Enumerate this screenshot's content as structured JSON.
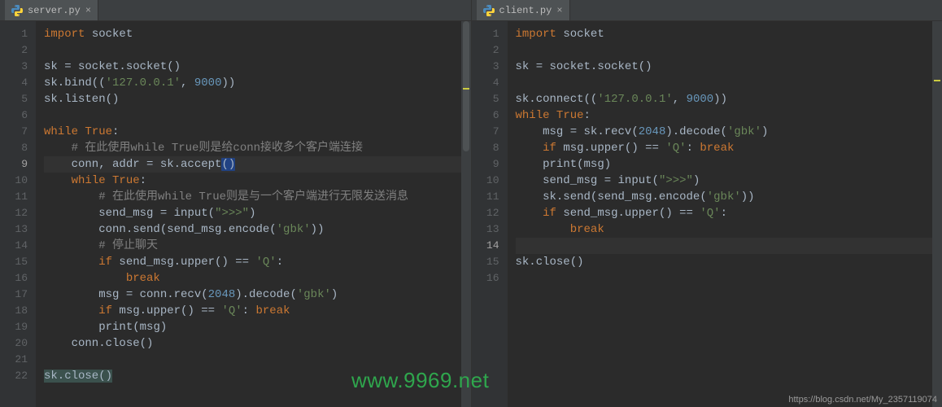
{
  "left": {
    "tab": {
      "filename": "server.py",
      "icon": "py-icon"
    },
    "current_line": 9,
    "lines": [
      {
        "n": 1,
        "tokens": [
          [
            "kw",
            "import"
          ],
          [
            "ident",
            " socket"
          ]
        ]
      },
      {
        "n": 2,
        "tokens": []
      },
      {
        "n": 3,
        "tokens": [
          [
            "ident",
            "sk = socket.socket()"
          ]
        ]
      },
      {
        "n": 4,
        "tokens": [
          [
            "ident",
            "sk.bind(("
          ],
          [
            "str",
            "'127.0.0.1'"
          ],
          [
            "ident",
            ", "
          ],
          [
            "num",
            "9000"
          ],
          [
            "ident",
            "))"
          ]
        ]
      },
      {
        "n": 5,
        "tokens": [
          [
            "ident",
            "sk.listen()"
          ]
        ]
      },
      {
        "n": 6,
        "tokens": []
      },
      {
        "n": 7,
        "tokens": [
          [
            "kw",
            "while "
          ],
          [
            "kw",
            "True"
          ],
          [
            "ident",
            ":"
          ]
        ]
      },
      {
        "n": 8,
        "tokens": [
          [
            "ident",
            "    "
          ],
          [
            "cm",
            "# 在此使用while True则是给conn接收多个客户端连接"
          ]
        ]
      },
      {
        "n": 9,
        "tokens": [
          [
            "ident",
            "    conn, addr = sk.accept"
          ],
          [
            "selbox",
            "()"
          ]
        ],
        "hl": true
      },
      {
        "n": 10,
        "tokens": [
          [
            "ident",
            "    "
          ],
          [
            "kw",
            "while "
          ],
          [
            "kw",
            "True"
          ],
          [
            "ident",
            ":"
          ]
        ]
      },
      {
        "n": 11,
        "tokens": [
          [
            "ident",
            "        "
          ],
          [
            "cm",
            "# 在此使用while True则是与一个客户端进行无限发送消息"
          ]
        ]
      },
      {
        "n": 12,
        "tokens": [
          [
            "ident",
            "        send_msg = "
          ],
          [
            "ident",
            "input"
          ],
          [
            "ident",
            "("
          ],
          [
            "str",
            "\">>>\""
          ],
          [
            "ident",
            ")"
          ]
        ]
      },
      {
        "n": 13,
        "tokens": [
          [
            "ident",
            "        conn.send(send_msg.encode("
          ],
          [
            "str",
            "'gbk'"
          ],
          [
            "ident",
            "))"
          ]
        ]
      },
      {
        "n": 14,
        "tokens": [
          [
            "ident",
            "        "
          ],
          [
            "cm",
            "# 停止聊天"
          ]
        ]
      },
      {
        "n": 15,
        "tokens": [
          [
            "ident",
            "        "
          ],
          [
            "kw",
            "if"
          ],
          [
            "ident",
            " send_msg.upper() == "
          ],
          [
            "str",
            "'Q'"
          ],
          [
            "ident",
            ":"
          ]
        ]
      },
      {
        "n": 16,
        "tokens": [
          [
            "ident",
            "            "
          ],
          [
            "kw",
            "break"
          ]
        ]
      },
      {
        "n": 17,
        "tokens": [
          [
            "ident",
            "        msg = conn.recv("
          ],
          [
            "num",
            "2048"
          ],
          [
            "ident",
            ").decode("
          ],
          [
            "str",
            "'gbk'"
          ],
          [
            "ident",
            ")"
          ]
        ]
      },
      {
        "n": 18,
        "tokens": [
          [
            "ident",
            "        "
          ],
          [
            "kw",
            "if"
          ],
          [
            "ident",
            " msg.upper() == "
          ],
          [
            "str",
            "'Q'"
          ],
          [
            "ident",
            ": "
          ],
          [
            "kw",
            "break"
          ]
        ]
      },
      {
        "n": 19,
        "tokens": [
          [
            "ident",
            "        "
          ],
          [
            "ident",
            "print"
          ],
          [
            "ident",
            "(msg)"
          ]
        ]
      },
      {
        "n": 20,
        "tokens": [
          [
            "ident",
            "    conn.close()"
          ]
        ]
      },
      {
        "n": 21,
        "tokens": []
      },
      {
        "n": 22,
        "tokens": [
          [
            "selbox-dim",
            "sk.close()"
          ]
        ]
      }
    ]
  },
  "right": {
    "tab": {
      "filename": "client.py",
      "icon": "py-icon"
    },
    "current_line": 14,
    "lines": [
      {
        "n": 1,
        "tokens": [
          [
            "kw",
            "import"
          ],
          [
            "ident",
            " socket"
          ]
        ]
      },
      {
        "n": 2,
        "tokens": []
      },
      {
        "n": 3,
        "tokens": [
          [
            "ident",
            "sk = socket.socket()"
          ]
        ]
      },
      {
        "n": 4,
        "tokens": []
      },
      {
        "n": 5,
        "tokens": [
          [
            "ident",
            "sk.connect(("
          ],
          [
            "str",
            "'127.0.0.1'"
          ],
          [
            "ident",
            ", "
          ],
          [
            "num",
            "9000"
          ],
          [
            "ident",
            "))"
          ]
        ]
      },
      {
        "n": 6,
        "tokens": [
          [
            "kw",
            "while "
          ],
          [
            "kw",
            "True"
          ],
          [
            "ident",
            ":"
          ]
        ]
      },
      {
        "n": 7,
        "tokens": [
          [
            "ident",
            "    msg = sk.recv("
          ],
          [
            "num",
            "2048"
          ],
          [
            "ident",
            ").decode("
          ],
          [
            "str",
            "'gbk'"
          ],
          [
            "ident",
            ")"
          ]
        ]
      },
      {
        "n": 8,
        "tokens": [
          [
            "ident",
            "    "
          ],
          [
            "kw",
            "if"
          ],
          [
            "ident",
            " msg.upper() == "
          ],
          [
            "str",
            "'Q'"
          ],
          [
            "ident",
            ": "
          ],
          [
            "kw",
            "break"
          ]
        ]
      },
      {
        "n": 9,
        "tokens": [
          [
            "ident",
            "    "
          ],
          [
            "ident",
            "print"
          ],
          [
            "ident",
            "(msg)"
          ]
        ]
      },
      {
        "n": 10,
        "tokens": [
          [
            "ident",
            "    send_msg = "
          ],
          [
            "ident",
            "input"
          ],
          [
            "ident",
            "("
          ],
          [
            "str",
            "\">>>\""
          ],
          [
            "ident",
            ")"
          ]
        ]
      },
      {
        "n": 11,
        "tokens": [
          [
            "ident",
            "    sk.send(send_msg.encode("
          ],
          [
            "str",
            "'gbk'"
          ],
          [
            "ident",
            "))"
          ]
        ]
      },
      {
        "n": 12,
        "tokens": [
          [
            "ident",
            "    "
          ],
          [
            "kw",
            "if"
          ],
          [
            "ident",
            " send_msg.upper() == "
          ],
          [
            "str",
            "'Q'"
          ],
          [
            "ident",
            ":"
          ]
        ]
      },
      {
        "n": 13,
        "tokens": [
          [
            "ident",
            "        "
          ],
          [
            "kw",
            "break"
          ]
        ]
      },
      {
        "n": 14,
        "tokens": [],
        "hl": true
      },
      {
        "n": 15,
        "tokens": [
          [
            "ident",
            "sk.close()"
          ]
        ]
      },
      {
        "n": 16,
        "tokens": []
      }
    ]
  },
  "watermark": "www.9969.net",
  "source_note": "https://blog.csdn.net/My_2357119074"
}
